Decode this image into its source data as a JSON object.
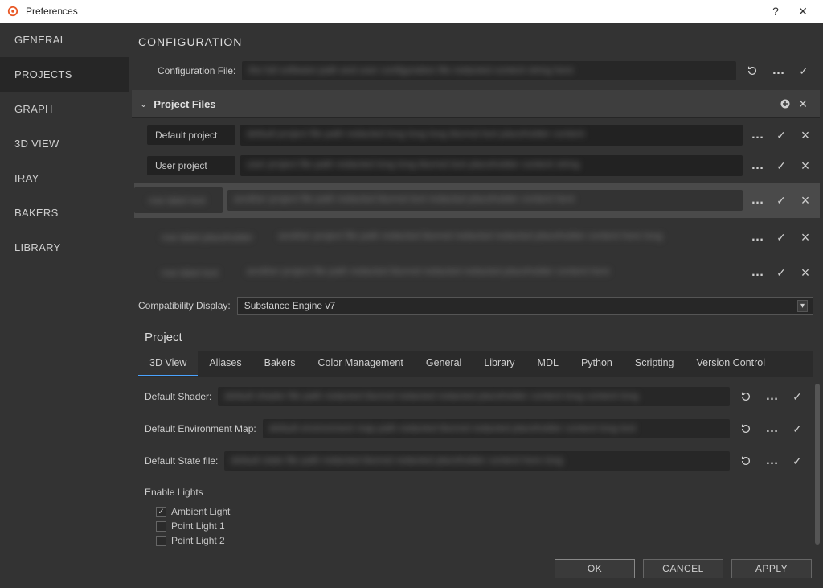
{
  "window": {
    "title": "Preferences"
  },
  "sidebar": {
    "items": [
      {
        "label": "GENERAL"
      },
      {
        "label": "PROJECTS"
      },
      {
        "label": "GRAPH"
      },
      {
        "label": "3D VIEW"
      },
      {
        "label": "IRAY"
      },
      {
        "label": "BAKERS"
      },
      {
        "label": "LIBRARY"
      }
    ],
    "active_index": 1
  },
  "configuration": {
    "heading": "CONFIGURATION",
    "file_label": "Configuration File:",
    "project_files": {
      "title": "Project Files",
      "rows": [
        {
          "label": "Default project"
        },
        {
          "label": "User project"
        }
      ]
    },
    "compat_label": "Compatibility Display:",
    "compat_value": "Substance Engine v7"
  },
  "project": {
    "heading": "Project",
    "tabs": [
      {
        "label": "3D View"
      },
      {
        "label": "Aliases"
      },
      {
        "label": "Bakers"
      },
      {
        "label": "Color Management"
      },
      {
        "label": "General"
      },
      {
        "label": "Library"
      },
      {
        "label": "MDL"
      },
      {
        "label": "Python"
      },
      {
        "label": "Scripting"
      },
      {
        "label": "Version Control"
      }
    ],
    "active_tab": 0,
    "fields": {
      "default_shader": "Default Shader:",
      "default_env": "Default Environment Map:",
      "default_state": "Default State file:"
    },
    "lights": {
      "title": "Enable Lights",
      "items": [
        {
          "label": "Ambient Light",
          "checked": true
        },
        {
          "label": "Point Light 1",
          "checked": false
        },
        {
          "label": "Point Light 2",
          "checked": false
        }
      ]
    }
  },
  "buttons": {
    "ok": "OK",
    "cancel": "CANCEL",
    "apply": "APPLY"
  }
}
